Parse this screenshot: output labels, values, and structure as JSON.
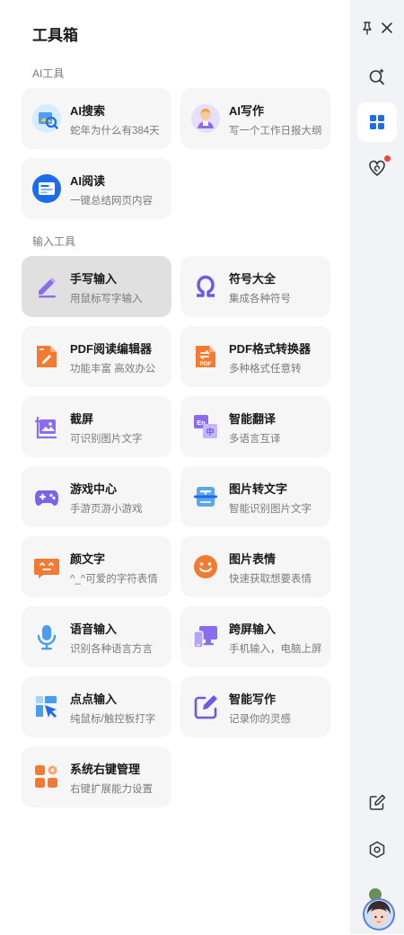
{
  "panel": {
    "title": "工具箱"
  },
  "sections": {
    "ai": "AI工具",
    "input": "输入工具"
  },
  "tools": {
    "ai_search": {
      "name": "AI搜索",
      "desc": "蛇年为什么有384天"
    },
    "ai_write": {
      "name": "AI写作",
      "desc": "写一个工作日报大纲"
    },
    "ai_read": {
      "name": "AI阅读",
      "desc": "一键总结网页内容"
    },
    "handwrite": {
      "name": "手写输入",
      "desc": "用鼠标写字输入"
    },
    "symbols": {
      "name": "符号大全",
      "desc": "集成各种符号"
    },
    "pdf_editor": {
      "name": "PDF阅读编辑器",
      "desc": "功能丰富 高效办公"
    },
    "pdf_convert": {
      "name": "PDF格式转换器",
      "desc": "多种格式任意转"
    },
    "screenshot": {
      "name": "截屏",
      "desc": "可识别图片文字"
    },
    "translate": {
      "name": "智能翻译",
      "desc": "多语言互译"
    },
    "games": {
      "name": "游戏中心",
      "desc": "手游页游小游戏"
    },
    "ocr": {
      "name": "图片转文字",
      "desc": "智能识别图片文字"
    },
    "kaomoji": {
      "name": "颜文字",
      "desc": "^_^可爱的字符表情"
    },
    "stickers": {
      "name": "图片表情",
      "desc": "快速获取想要表情"
    },
    "voice": {
      "name": "语音输入",
      "desc": "识别各种语言方言"
    },
    "cross_screen": {
      "name": "跨屏输入",
      "desc": "手机输入，电脑上屏"
    },
    "click_input": {
      "name": "点点输入",
      "desc": "纯鼠标/触控板打字"
    },
    "smart_write": {
      "name": "智能写作",
      "desc": "记录你的灵感"
    },
    "context_menu": {
      "name": "系统右键管理",
      "desc": "右键扩展能力设置"
    }
  },
  "icons": {
    "pin": "pin-icon",
    "close": "close-icon",
    "ai_search": "sparkle-search-icon",
    "toolbox": "grid-icon",
    "skin": "heart-spiral-icon",
    "edit": "edit-icon",
    "settings": "hexagon-settings-icon",
    "avatar": "avatar"
  },
  "colors": {
    "accent": "#1d6cf0",
    "notification": "#f0443a",
    "card_bg": "#f6f6f7",
    "card_selected": "#e0e0e0"
  }
}
